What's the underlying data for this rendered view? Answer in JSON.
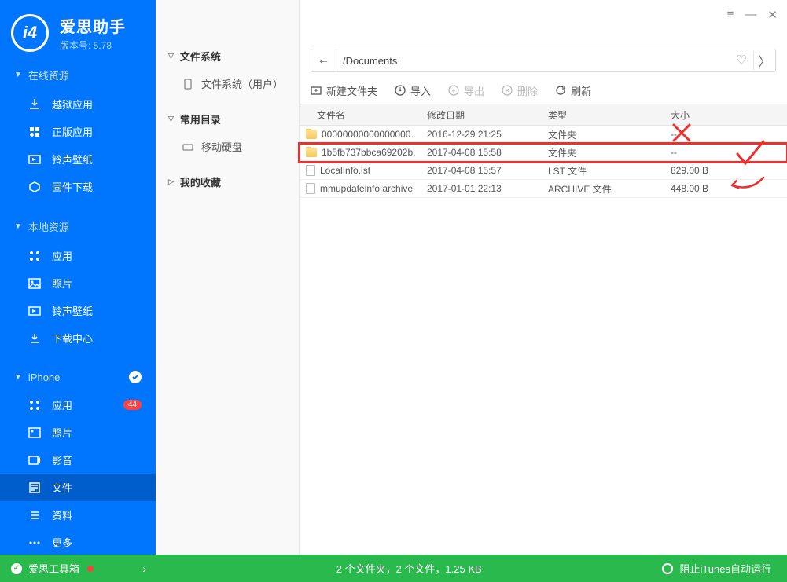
{
  "app": {
    "name": "爱思助手",
    "version_label": "版本号: 5.78"
  },
  "sidebar": {
    "sections": [
      {
        "title": "在线资源",
        "items": [
          {
            "label": "越狱应用"
          },
          {
            "label": "正版应用"
          },
          {
            "label": "铃声壁纸"
          },
          {
            "label": "固件下载"
          }
        ]
      },
      {
        "title": "本地资源",
        "items": [
          {
            "label": "应用"
          },
          {
            "label": "照片"
          },
          {
            "label": "铃声壁纸"
          },
          {
            "label": "下载中心"
          }
        ]
      },
      {
        "title": "iPhone",
        "checked": true,
        "items": [
          {
            "label": "应用",
            "badge": "44"
          },
          {
            "label": "照片"
          },
          {
            "label": "影音"
          },
          {
            "label": "文件",
            "active": true
          },
          {
            "label": "资料"
          },
          {
            "label": "更多"
          }
        ]
      }
    ]
  },
  "bottom": {
    "tools": "爱思工具箱",
    "status": "2 个文件夹，2 个文件，1.25 KB",
    "itunes": "阻止iTunes自动运行"
  },
  "mid": {
    "sections": [
      {
        "title": "文件系统",
        "items": [
          {
            "label": "文件系统（用户）"
          }
        ]
      },
      {
        "title": "常用目录",
        "items": [
          {
            "label": "移动硬盘"
          }
        ]
      },
      {
        "title": "我的收藏",
        "items": []
      }
    ]
  },
  "path": {
    "value": "/Documents"
  },
  "toolbar": {
    "new_folder": "新建文件夹",
    "import": "导入",
    "export": "导出",
    "delete": "删除",
    "refresh": "刷新"
  },
  "table": {
    "headers": {
      "name": "文件名",
      "date": "修改日期",
      "type": "类型",
      "size": "大小"
    },
    "rows": [
      {
        "name": "00000000000000000..",
        "date": "2016-12-29 21:25",
        "type": "文件夹",
        "size": "--",
        "kind": "folder"
      },
      {
        "name": "1b5fb737bbca69202b.",
        "date": "2017-04-08 15:58",
        "type": "文件夹",
        "size": "--",
        "kind": "folder",
        "highlight": true
      },
      {
        "name": "LocalInfo.lst",
        "date": "2017-04-08 15:57",
        "type": "LST 文件",
        "size": "829.00 B",
        "kind": "file"
      },
      {
        "name": "mmupdateinfo.archive",
        "date": "2017-01-01 22:13",
        "type": "ARCHIVE 文件",
        "size": "448.00 B",
        "kind": "file"
      }
    ]
  }
}
